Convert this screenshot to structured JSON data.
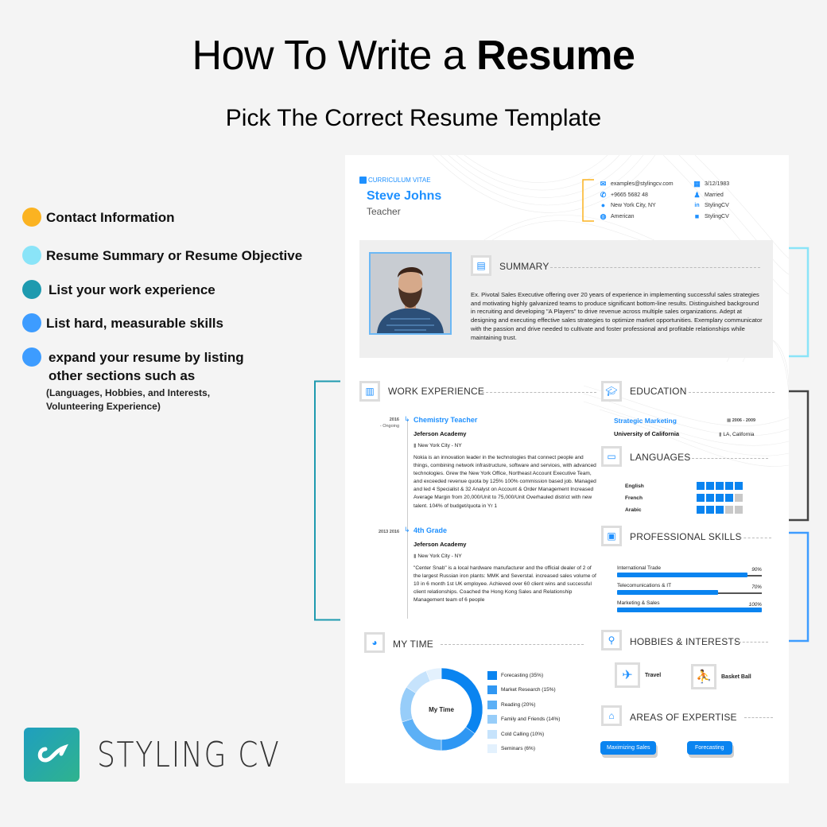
{
  "header": {
    "title_regular": "How To Write a ",
    "title_bold": "Resume",
    "subtitle": "Pick The Correct Resume Template"
  },
  "legend": {
    "items": [
      {
        "label": "Contact Information",
        "color": "#fbb321"
      },
      {
        "label": "Resume Summary or Resume Objective",
        "color": "#8ae4f8"
      },
      {
        "label": "List your work experience",
        "color": "#1e9aaf"
      },
      {
        "label": "List hard, measurable skills",
        "color": "#3d9cff"
      },
      {
        "label": "expand your resume by listing other sections such as",
        "color": "#3d9cff",
        "sub": "(Languages, Hobbies, and Interests, Volunteering Experience)"
      }
    ]
  },
  "brand": {
    "name": "STYLING CV"
  },
  "resume": {
    "tag": "CURRICULUM VITAE",
    "name": "Steve Johns",
    "role": "Teacher",
    "contact_left": [
      {
        "icon": "email-icon",
        "glyph": "✉",
        "text": "examples@stylingcv.com"
      },
      {
        "icon": "phone-icon",
        "glyph": "✆",
        "text": "+9665 5682 48"
      },
      {
        "icon": "location-icon",
        "glyph": "●",
        "text": "New York City, NY"
      },
      {
        "icon": "globe-icon",
        "glyph": "◍",
        "text": "American"
      }
    ],
    "contact_right": [
      {
        "icon": "calendar-icon",
        "glyph": "▦",
        "text": "3/12/1983"
      },
      {
        "icon": "person-icon",
        "glyph": "♟",
        "text": "Married"
      },
      {
        "icon": "linkedin-icon",
        "glyph": "in",
        "text": "StylingCV"
      },
      {
        "icon": "twitter-icon",
        "glyph": "■",
        "text": "StylingCV"
      }
    ],
    "summary": {
      "title": "SUMMARY",
      "text": "Ex. Pivotal Sales Executive offering over 20 years of experience in implementing successful sales strategies and motivating highly galvanized teams to produce significant bottom-line results. Distinguished background in recruiting and developing \"A Players\" to drive revenue across multiple sales organizations. Adept at designing and executing effective sales strategies to optimize market opportunities. Exemplary communicator with the passion and drive needed to cultivate and foster professional and profitable relationships while maintaining trust."
    },
    "work": {
      "title": "WORK EXPERIENCE",
      "jobs": [
        {
          "date": "2016",
          "date2": "- Ongoing",
          "title": "Chemistry Teacher",
          "org": "Jeferson Academy",
          "location": "New York City - NY",
          "desc": "Nokia is an innovation leader in the technologies that connect people and things, combining network infrastructure, software and services, with advanced technologies. Grew the New York Office, Northeast Account Executive Team, and exceeded revenue quota by 125% 100% commission based job. Managed and led 4 Specialist & 32 Analyst on Account & Order Management Increased Average Margin from 20,000/Unit to 75,000/Unit Overhauled district with new talent. 104% of budget/quota in Yr 1"
        },
        {
          "date": "2013 2016",
          "date2": "",
          "title": "4th Grade",
          "org": "Jeferson Academy",
          "location": "New York City - NY",
          "desc": "\"Center Snab\" is a local hardware manufacturer and the official dealer of 2 of the largest Russian iron plants: MMK and Severstal. increased sales volume of 10 in 6 month 1st UK employee. Achieved over 60 client wins and successful client relationships. Coached the Hong Kong Sales and Relationship Management team of 6 people"
        }
      ]
    },
    "education": {
      "title": "EDUCATION",
      "degree": "Strategic Marketing",
      "school": "University of California",
      "dates": "2006 - 2009",
      "location": "LA, California"
    },
    "languages": {
      "title": "LANGUAGES",
      "items": [
        {
          "name": "English",
          "level": 5,
          "max": 5
        },
        {
          "name": "French",
          "level": 4,
          "max": 5
        },
        {
          "name": "Arabic",
          "level": 3,
          "max": 5
        }
      ]
    },
    "skills": {
      "title": "PROFESSIONAL SKILLS",
      "items": [
        {
          "name": "International Trade",
          "percent": 90,
          "label": "90%"
        },
        {
          "name": "Telecomunications & IT",
          "percent": 70,
          "label": "70%"
        },
        {
          "name": "Marketing & Sales",
          "percent": 100,
          "label": "100%"
        }
      ]
    },
    "my_time": {
      "title": "MY TIME",
      "center_label": "My Time"
    },
    "hobbies": {
      "title": "HOBBIES & INTERESTS",
      "items": [
        {
          "label": "Travel",
          "icon": "airplane-icon",
          "glyph": "✈"
        },
        {
          "label": "Basket Ball",
          "icon": "basketball-icon",
          "glyph": "⛹"
        }
      ]
    },
    "expertise": {
      "title": "AREAS OF EXPERTISE",
      "chips": [
        "Maximizing Sales",
        "Forecasting"
      ]
    }
  },
  "chart_data": {
    "type": "pie",
    "title": "My Time",
    "categories": [
      "Forecasting",
      "Market Research",
      "Reading",
      "Family and Friends",
      "Cold Calling",
      "Seminars"
    ],
    "values": [
      35,
      15,
      20,
      14,
      10,
      6
    ],
    "labels": [
      "Forecasting (35%)",
      "Market Research (15%)",
      "Reading (20%)",
      "Family and Friends (14%)",
      "Cold Calling (10%)",
      "Seminars (6%)"
    ],
    "colors": [
      "#0a84f0",
      "#2f97f3",
      "#5cb0f6",
      "#97cdf9",
      "#c6e3fc",
      "#e3f1fd"
    ],
    "donut": true,
    "legend": "right"
  }
}
